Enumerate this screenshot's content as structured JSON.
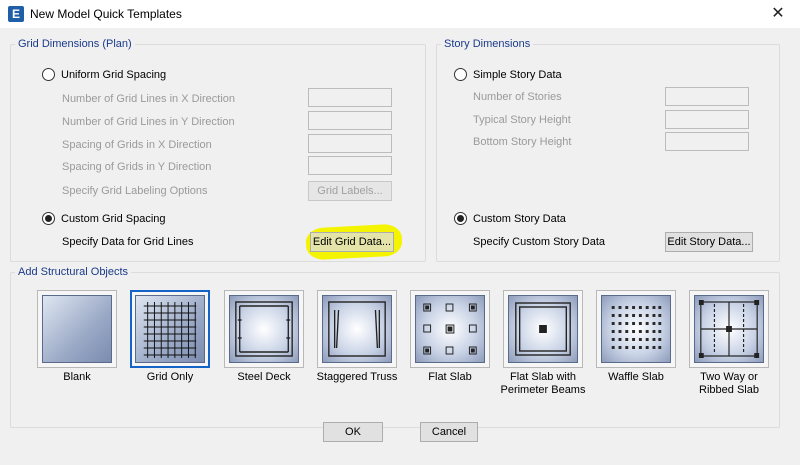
{
  "window": {
    "title": "New Model Quick Templates",
    "app_icon_letter": "E",
    "close_glyph": "✕"
  },
  "grid_dimensions": {
    "legend": "Grid Dimensions (Plan)",
    "uniform_label": "Uniform Grid Spacing",
    "uniform_selected": false,
    "fields": [
      {
        "label": "Number of Grid Lines in X Direction",
        "value": ""
      },
      {
        "label": "Number of Grid Lines in Y Direction",
        "value": ""
      },
      {
        "label": "Spacing of Grids in X Direction",
        "value": ""
      },
      {
        "label": "Spacing of Grids in Y Direction",
        "value": ""
      }
    ],
    "labeling_label": "Specify Grid Labeling Options",
    "grid_labels_button": "Grid Labels...",
    "custom_label": "Custom Grid Spacing",
    "custom_selected": true,
    "specify_data_label": "Specify Data for Grid Lines",
    "edit_grid_button": "Edit Grid Data..."
  },
  "story_dimensions": {
    "legend": "Story Dimensions",
    "simple_label": "Simple Story Data",
    "simple_selected": false,
    "fields": [
      {
        "label": "Number of Stories",
        "value": ""
      },
      {
        "label": "Typical Story Height",
        "value": ""
      },
      {
        "label": "Bottom Story Height",
        "value": ""
      }
    ],
    "custom_label": "Custom Story Data",
    "custom_selected": true,
    "specify_custom_label": "Specify Custom Story Data",
    "edit_story_button": "Edit Story Data..."
  },
  "structural_objects": {
    "legend": "Add Structural Objects",
    "selected_index": 1,
    "tiles": [
      {
        "label": "Blank",
        "icon": "blank-template-icon"
      },
      {
        "label": "Grid Only",
        "icon": "grid-only-template-icon"
      },
      {
        "label": "Steel Deck",
        "icon": "steel-deck-template-icon"
      },
      {
        "label": "Staggered Truss",
        "icon": "staggered-truss-template-icon"
      },
      {
        "label": "Flat Slab",
        "icon": "flat-slab-template-icon"
      },
      {
        "label": "Flat Slab with\nPerimeter Beams",
        "icon": "flat-slab-perimeter-beams-template-icon"
      },
      {
        "label": "Waffle Slab",
        "icon": "waffle-slab-template-icon"
      },
      {
        "label": "Two Way or\nRibbed Slab",
        "icon": "two-way-ribbed-slab-template-icon"
      }
    ]
  },
  "footer": {
    "ok_button": "OK",
    "cancel_button": "Cancel"
  },
  "colors": {
    "legend_text": "#1a3a8a",
    "selection_border": "#1464c8",
    "highlight": "#f4f400",
    "disabled_text": "#9a9a9a"
  }
}
